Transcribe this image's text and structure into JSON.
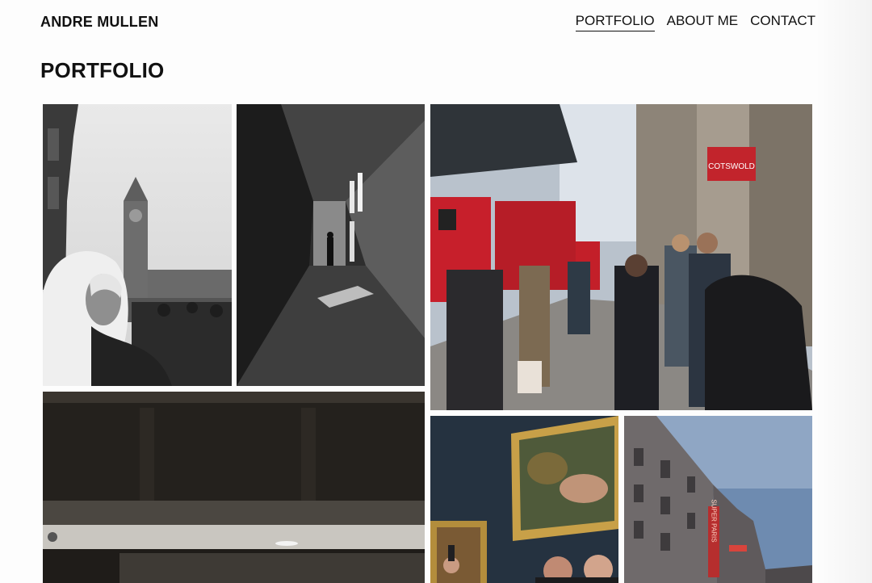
{
  "header": {
    "brand": "ANDRE MULLEN",
    "nav": [
      {
        "label": "PORTFOLIO",
        "active": true
      },
      {
        "label": "ABOUT ME",
        "active": false
      },
      {
        "label": "CONTACT",
        "active": false
      }
    ]
  },
  "main": {
    "title": "PORTFOLIO",
    "photos": [
      {
        "subject": "big-ben-woman-hijab",
        "tone": "monochrome"
      },
      {
        "subject": "concrete-corridor-light",
        "tone": "monochrome"
      },
      {
        "subject": "london-street-crowd-buses",
        "tone": "color",
        "sign_text": "COTSWOLD"
      },
      {
        "subject": "dark-interior-bar",
        "tone": "color"
      },
      {
        "subject": "museum-painting-visitors",
        "tone": "color"
      },
      {
        "subject": "parisian-building-neon",
        "tone": "color",
        "sign_text": "SUPER PARIS"
      }
    ]
  }
}
